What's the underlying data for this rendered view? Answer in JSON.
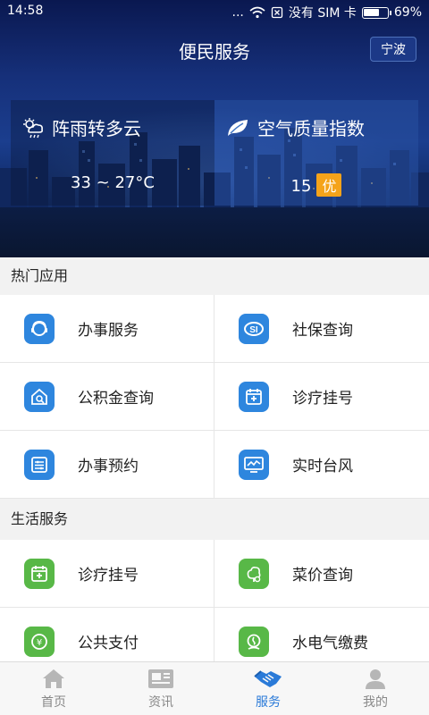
{
  "status_bar": {
    "time": "14:58",
    "dots": "...",
    "carrier": "没有 SIM 卡",
    "battery_pct": "69%",
    "battery_level": 0.69
  },
  "header": {
    "title": "便民服务",
    "city": "宁波"
  },
  "weather": {
    "icon": "cloud-rain-icon",
    "desc": "阵雨转多云",
    "temp": "33 ~ 27°C"
  },
  "air_quality": {
    "icon": "leaf-icon",
    "title": "空气质量指数",
    "value": "15",
    "level": "优"
  },
  "hot_apps": {
    "title": "热门应用",
    "items": [
      {
        "label": "办事服务",
        "icon": "service-agent-icon"
      },
      {
        "label": "社保查询",
        "icon": "social-security-icon"
      },
      {
        "label": "公积金查询",
        "icon": "housing-fund-icon"
      },
      {
        "label": "诊疗挂号",
        "icon": "medical-calendar-icon"
      },
      {
        "label": "办事预约",
        "icon": "appointment-icon"
      },
      {
        "label": "实时台风",
        "icon": "typhoon-monitor-icon"
      }
    ]
  },
  "life_services": {
    "title": "生活服务",
    "items": [
      {
        "label": "诊疗挂号",
        "icon": "medical-calendar-icon"
      },
      {
        "label": "菜价查询",
        "icon": "vegetable-price-icon"
      },
      {
        "label": "公共支付",
        "icon": "yuan-payment-icon"
      },
      {
        "label": "水电气缴费",
        "icon": "utility-payment-icon"
      }
    ]
  },
  "tabs": [
    {
      "label": "首页",
      "icon": "home-icon",
      "active": false
    },
    {
      "label": "资讯",
      "icon": "news-icon",
      "active": false
    },
    {
      "label": "服务",
      "icon": "handshake-icon",
      "active": true
    },
    {
      "label": "我的",
      "icon": "user-icon",
      "active": false
    }
  ],
  "colors": {
    "accent_blue": "#2e86de",
    "accent_green": "#58b847",
    "aqi_badge": "#f5a31a",
    "tab_active": "#2a7ad8"
  }
}
